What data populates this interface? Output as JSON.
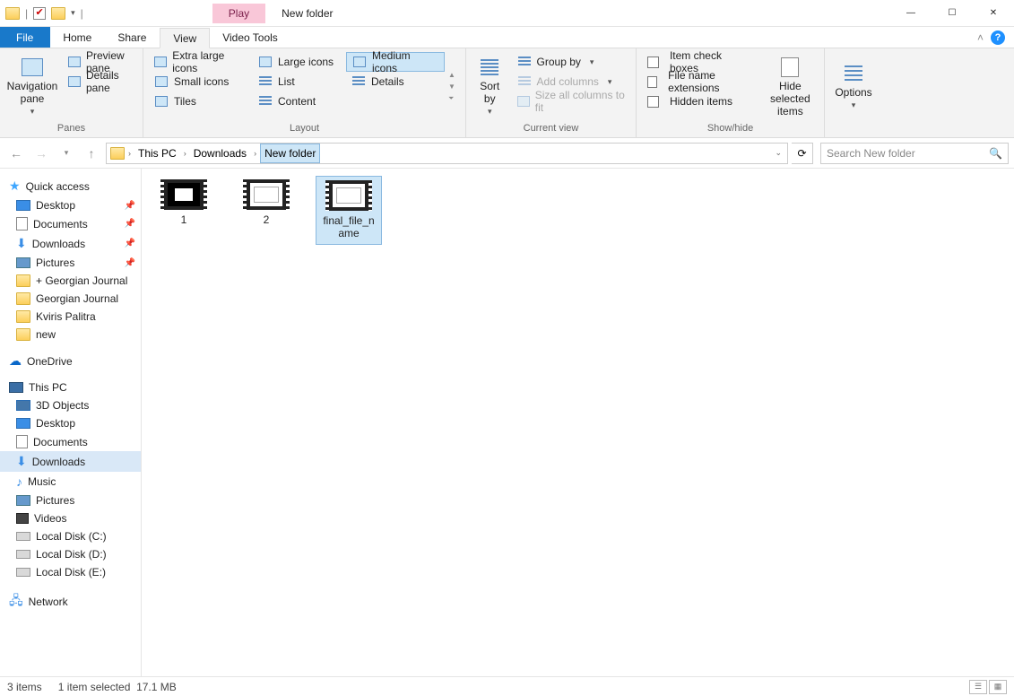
{
  "titlebar": {
    "play_tab": "Play",
    "title": "New folder"
  },
  "tabs": {
    "file": "File",
    "home": "Home",
    "share": "Share",
    "view": "View",
    "video_tools": "Video Tools"
  },
  "ribbon": {
    "panes": {
      "navigation_pane": "Navigation pane",
      "preview_pane": "Preview pane",
      "details_pane": "Details pane",
      "label": "Panes"
    },
    "layout": {
      "extra_large": "Extra large icons",
      "large": "Large icons",
      "medium": "Medium icons",
      "small": "Small icons",
      "list": "List",
      "details": "Details",
      "tiles": "Tiles",
      "content": "Content",
      "label": "Layout"
    },
    "current_view": {
      "sort_by": "Sort by",
      "group_by": "Group by",
      "add_columns": "Add columns",
      "size_all": "Size all columns to fit",
      "label": "Current view"
    },
    "show_hide": {
      "item_check": "Item check boxes",
      "file_ext": "File name extensions",
      "hidden": "Hidden items",
      "hide_selected": "Hide selected items",
      "label": "Show/hide"
    },
    "options": "Options"
  },
  "breadcrumb": {
    "this_pc": "This PC",
    "downloads": "Downloads",
    "new_folder": "New folder"
  },
  "search_placeholder": "Search New folder",
  "tree": {
    "quick_access": "Quick access",
    "desktop": "Desktop",
    "documents": "Documents",
    "downloads": "Downloads",
    "pictures": "Pictures",
    "georgian_plus": "+ Georgian Journal",
    "georgian": "Georgian Journal",
    "kviris": "Kviris Palitra",
    "new": "new",
    "onedrive": "OneDrive",
    "this_pc": "This PC",
    "objects3d": "3D Objects",
    "desktop2": "Desktop",
    "documents2": "Documents",
    "downloads2": "Downloads",
    "music": "Music",
    "pictures2": "Pictures",
    "videos": "Videos",
    "local_c": "Local Disk (C:)",
    "local_d": "Local Disk (D:)",
    "local_e": "Local Disk (E:)",
    "network": "Network"
  },
  "files": {
    "f1": "1",
    "f2": "2",
    "f3": "final_file_name"
  },
  "status": {
    "items": "3 items",
    "selected": "1 item selected",
    "size": "17.1 MB"
  }
}
